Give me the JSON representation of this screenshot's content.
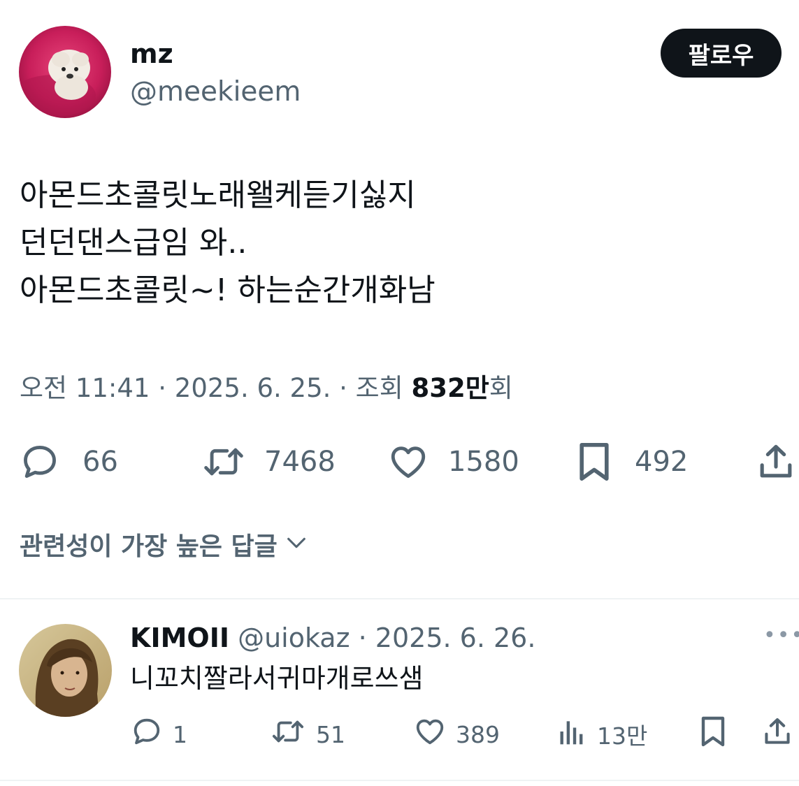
{
  "author": {
    "name": "mz",
    "handle": "@meekieem",
    "follow_label": "팔로우"
  },
  "tweet": {
    "lines": [
      "아몬드초콜릿노래왤케듣기싫지",
      "던던댄스급임 와..",
      "아몬드초콜릿~! 하는순간개화남"
    ],
    "time": "오전 11:41",
    "sep": " · ",
    "date": "2025. 6. 25.",
    "views_prefix": "조회 ",
    "views_number": "832만",
    "views_suffix": "회"
  },
  "actions": {
    "replies": "66",
    "retweets": "7468",
    "likes": "1580",
    "bookmarks": "492"
  },
  "sort": {
    "label": "관련성이 가장 높은 답글"
  },
  "reply": {
    "name": "KIMOII",
    "handle": "@uiokaz",
    "date_sep": " · ",
    "date": "2025. 6. 26.",
    "more": "•••",
    "text": "니꼬치짤라서귀마개로쓰샘",
    "replies": "1",
    "retweets": "51",
    "likes": "389",
    "views": "13만"
  },
  "colors": {
    "text": "#0f1419",
    "muted": "#536471",
    "divider": "#eff3f4"
  }
}
